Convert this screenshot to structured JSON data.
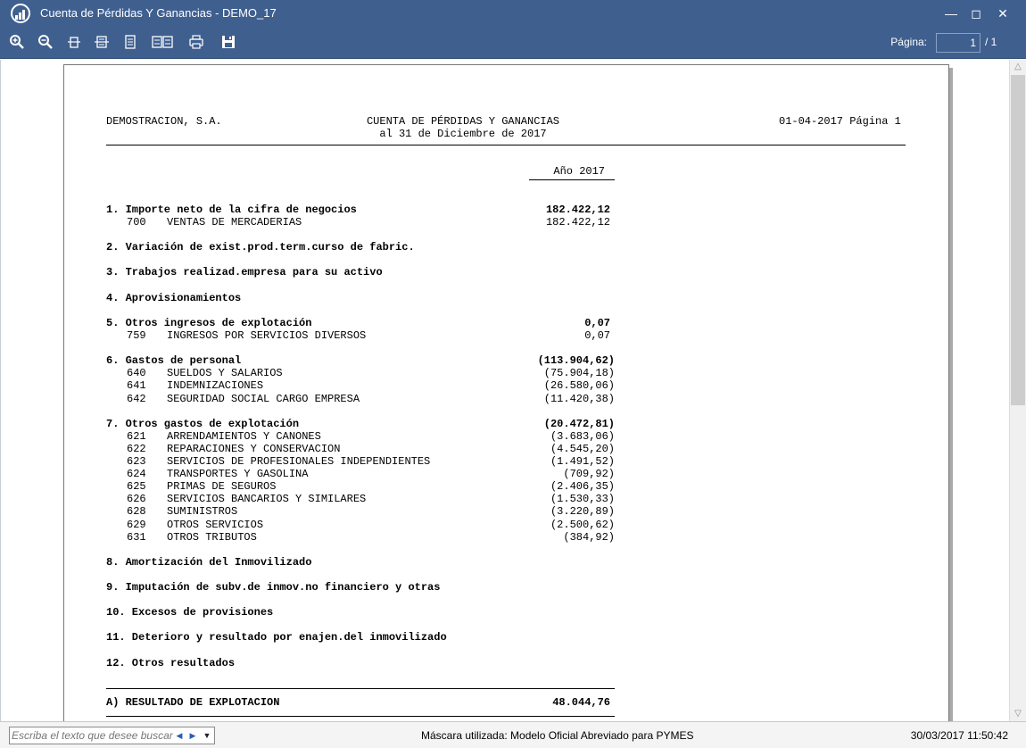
{
  "window": {
    "title": "Cuenta de Pérdidas Y Ganancias - DEMO_17"
  },
  "toolbar": {
    "page_label": "Página:",
    "page_value": "1",
    "page_total": "/ 1"
  },
  "report": {
    "company": "DEMOSTRACION, S.A.",
    "title": "CUENTA DE PÉRDIDAS Y GANANCIAS",
    "subtitle": "al 31 de Diciembre de 2017",
    "date_page": "01-04-2017 Página 1",
    "column_header": "Año 2017",
    "sections": [
      {
        "label": "1. Importe neto de la cifra de negocios",
        "amount": "182.422,12",
        "lines": [
          {
            "code": "700",
            "name": "VENTAS DE MERCADERIAS",
            "amount": "182.422,12"
          }
        ]
      },
      {
        "label": "2. Variación de exist.prod.term.curso de fabric.",
        "amount": "",
        "lines": []
      },
      {
        "label": "3. Trabajos realizad.empresa para su activo",
        "amount": "",
        "lines": []
      },
      {
        "label": "4. Aprovisionamientos",
        "amount": "",
        "lines": []
      },
      {
        "label": "5. Otros ingresos de explotación",
        "amount": "0,07",
        "lines": [
          {
            "code": "759",
            "name": "INGRESOS POR SERVICIOS DIVERSOS",
            "amount": "0,07"
          }
        ]
      },
      {
        "label": "6. Gastos de personal",
        "amount": "(113.904,62)",
        "lines": [
          {
            "code": "640",
            "name": "SUELDOS Y SALARIOS",
            "amount": "(75.904,18)"
          },
          {
            "code": "641",
            "name": "INDEMNIZACIONES",
            "amount": "(26.580,06)"
          },
          {
            "code": "642",
            "name": "SEGURIDAD SOCIAL CARGO EMPRESA",
            "amount": "(11.420,38)"
          }
        ]
      },
      {
        "label": "7. Otros gastos de explotación",
        "amount": "(20.472,81)",
        "lines": [
          {
            "code": "621",
            "name": "ARRENDAMIENTOS Y CANONES",
            "amount": "(3.683,06)"
          },
          {
            "code": "622",
            "name": "REPARACIONES Y CONSERVACION",
            "amount": "(4.545,20)"
          },
          {
            "code": "623",
            "name": "SERVICIOS DE PROFESIONALES INDEPENDIENTES",
            "amount": "(1.491,52)"
          },
          {
            "code": "624",
            "name": "TRANSPORTES Y GASOLINA",
            "amount": "(709,92)"
          },
          {
            "code": "625",
            "name": "PRIMAS DE SEGUROS",
            "amount": "(2.406,35)"
          },
          {
            "code": "626",
            "name": "SERVICIOS BANCARIOS Y SIMILARES",
            "amount": "(1.530,33)"
          },
          {
            "code": "628",
            "name": "SUMINISTROS",
            "amount": "(3.220,89)"
          },
          {
            "code": "629",
            "name": "OTROS SERVICIOS",
            "amount": "(2.500,62)"
          },
          {
            "code": "631",
            "name": "OTROS TRIBUTOS",
            "amount": "(384,92)"
          }
        ]
      },
      {
        "label": "8. Amortización del Inmovilizado",
        "amount": "",
        "lines": []
      },
      {
        "label": "9. Imputación de subv.de inmov.no financiero y otras",
        "amount": "",
        "lines": []
      },
      {
        "label": "10. Excesos de provisiones",
        "amount": "",
        "lines": []
      },
      {
        "label": "11. Deterioro y resultado por enajen.del inmovilizado",
        "amount": "",
        "lines": []
      },
      {
        "label": "12. Otros resultados",
        "amount": "",
        "lines": []
      }
    ],
    "result": {
      "label": "A) RESULTADO DE EXPLOTACION",
      "amount": "48.044,76"
    }
  },
  "statusbar": {
    "search_placeholder": "Escriba el texto que desee buscar",
    "mask": "Máscara utilizada: Modelo Oficial Abreviado para PYMES",
    "datetime": "30/03/2017 11:50:42"
  },
  "colors": {
    "titlebar": "#3f5f8f",
    "page_bg": "#ffffff"
  }
}
